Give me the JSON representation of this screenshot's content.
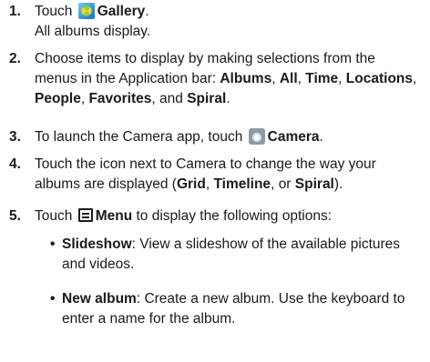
{
  "steps": [
    {
      "num": "1.",
      "line1_pre": "Touch",
      "line1_bold": "Gallery",
      "line1_post": ".",
      "line2": "All albums display."
    },
    {
      "num": "2.",
      "text_pre": "Choose items to display by making selections from the menus in the Application bar:",
      "items": [
        "Albums",
        "All",
        "Time",
        "Locations",
        "People",
        "Favorites",
        "Spiral"
      ],
      "and_word": "and"
    },
    {
      "num": "3.",
      "text_pre": "To launch the Camera app, touch",
      "bold": "Camera",
      "post": "."
    },
    {
      "num": "4.",
      "text_pre": "Touch the icon next to Camera to change the way your albums are displayed (",
      "opts": [
        "Grid",
        "Timeline",
        "Spiral"
      ],
      "or_word": "or",
      "post": ")."
    },
    {
      "num": "5.",
      "pre": "Touch",
      "bold": "Menu",
      "post": "to display the following options:"
    }
  ],
  "bullets": [
    {
      "label": "Slideshow",
      "text": ": View a slideshow of the available pictures and videos."
    },
    {
      "label": "New album",
      "text": ": Create a new album. Use the keyboard to enter a name for the album."
    }
  ],
  "icons": {
    "gallery": "gallery-icon",
    "camera": "camera-icon",
    "menu": "menu-icon"
  }
}
